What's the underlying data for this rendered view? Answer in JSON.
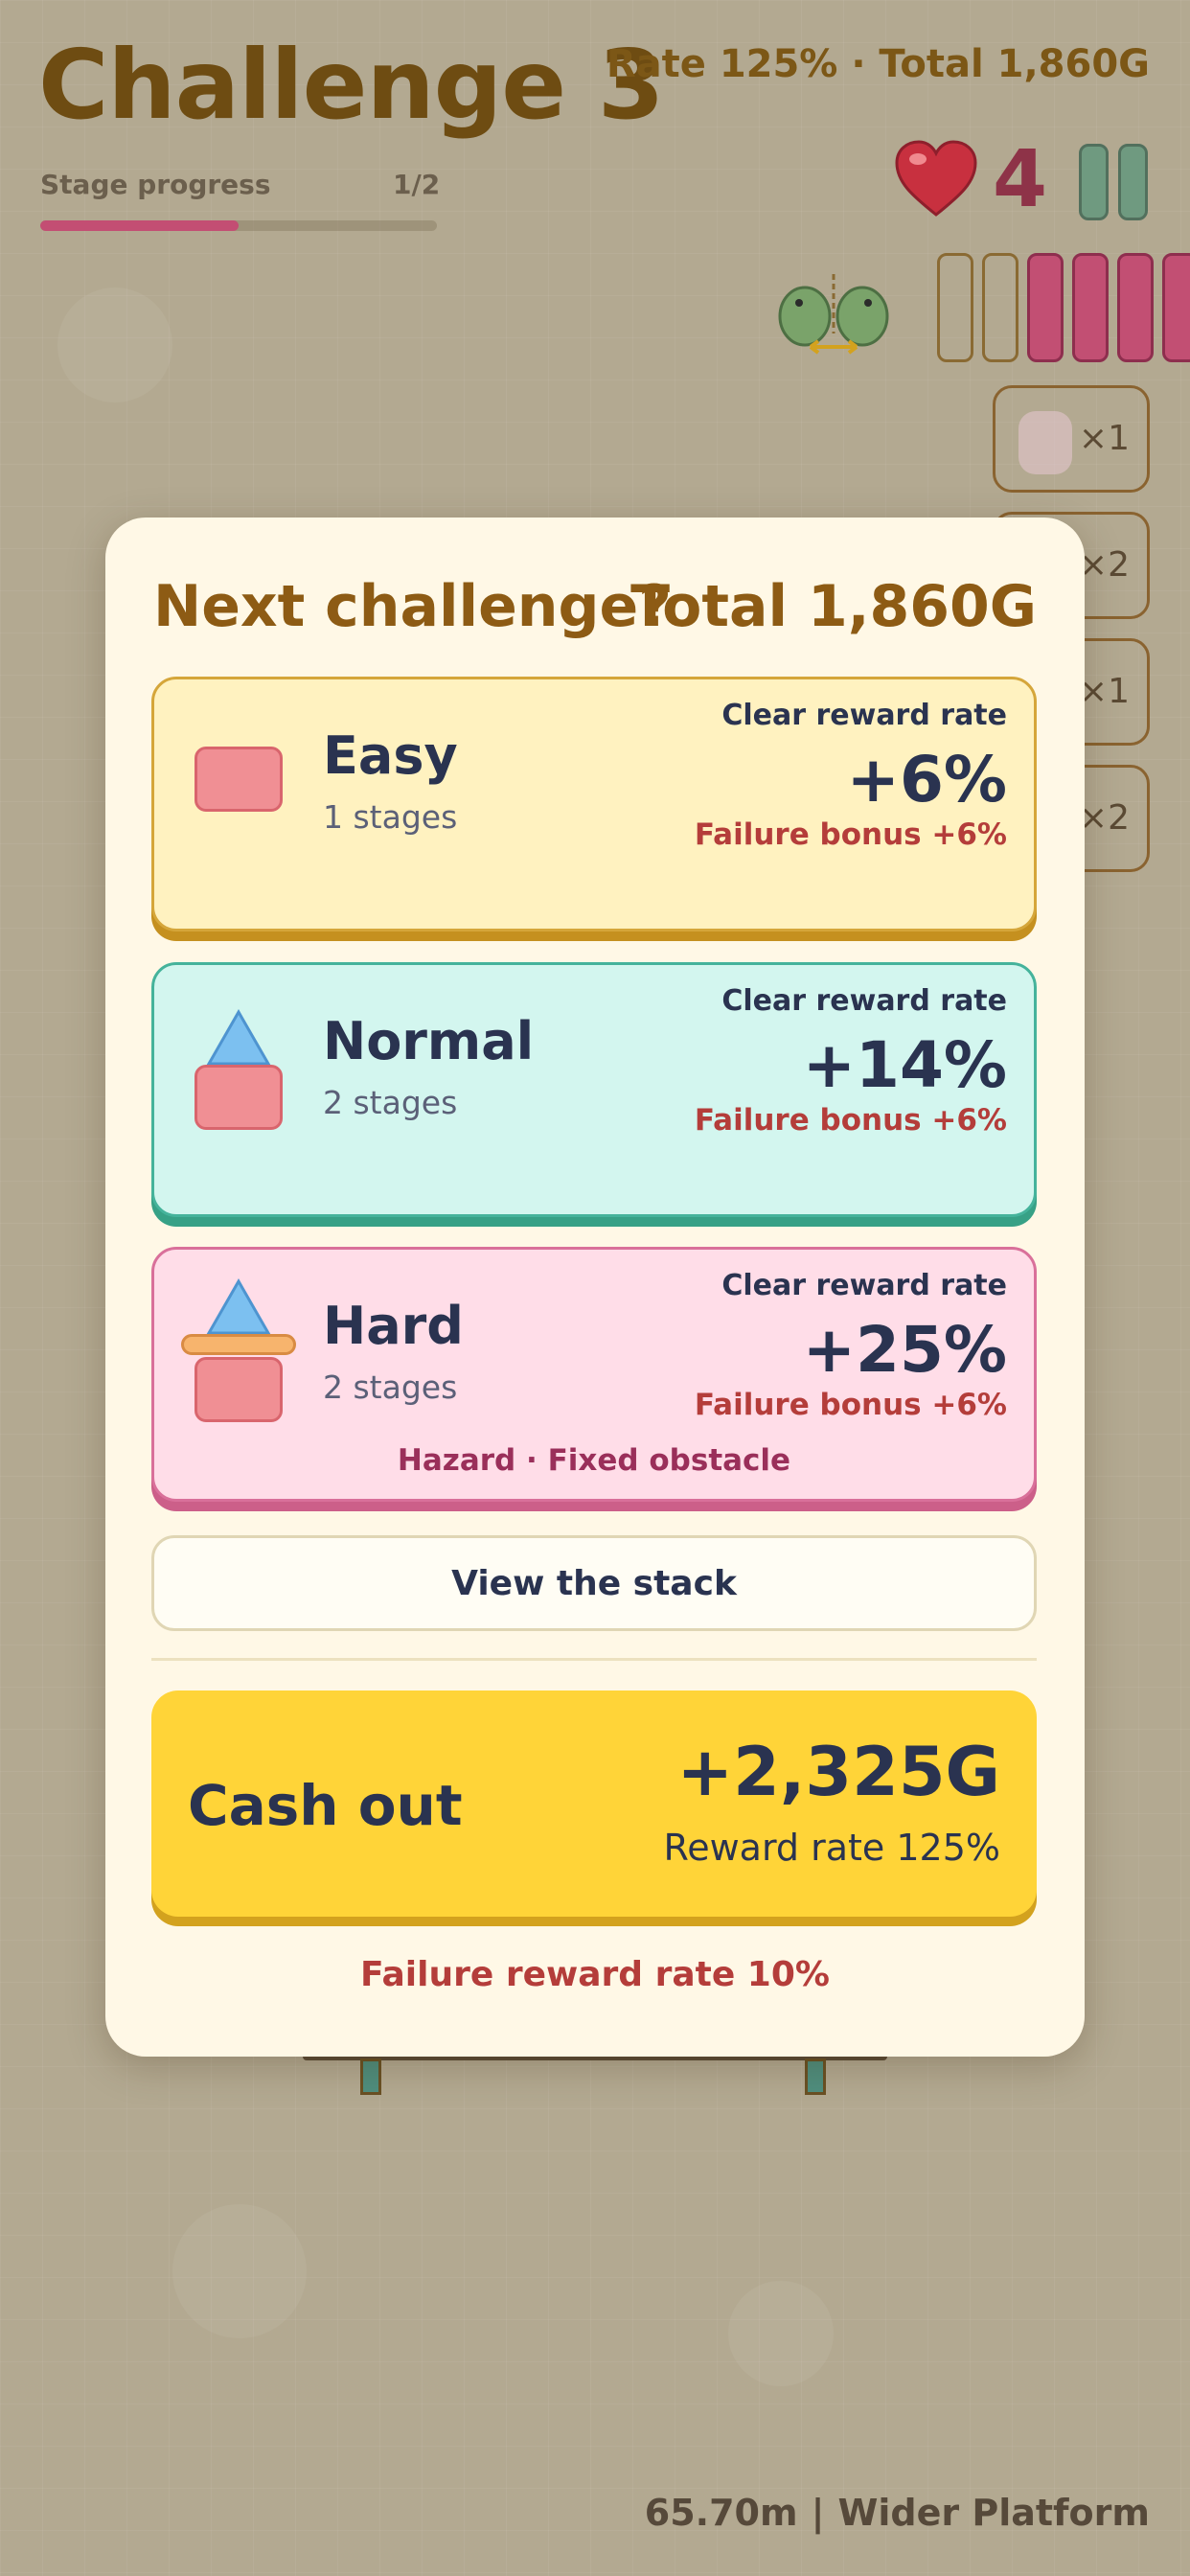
{
  "hud": {
    "title": "Challenge 3",
    "rate_total": "Rate 125% · Total 1,860G",
    "stage_label": "Stage progress",
    "stage_count": "1/2",
    "stage_progress": 0.5,
    "lives": "4",
    "slots_filled": 4,
    "slots_total": 6
  },
  "inventory": [
    {
      "qty": "×1",
      "icon": "ghost-doll-icon"
    },
    {
      "qty": "×2",
      "icon": "item-icon"
    },
    {
      "qty": "×1",
      "icon": "item-icon"
    },
    {
      "qty": "×2",
      "icon": "item-icon"
    }
  ],
  "modal": {
    "title": "Next challenge?",
    "total": "Total 1,860G",
    "options": [
      {
        "name": "Easy",
        "stages": "1 stages",
        "rate_label": "Clear reward rate",
        "rate": "+6%",
        "failure_bonus": "Failure bonus +6%",
        "tags": ""
      },
      {
        "name": "Normal",
        "stages": "2 stages",
        "rate_label": "Clear reward rate",
        "rate": "+14%",
        "failure_bonus": "Failure bonus +6%",
        "tags": ""
      },
      {
        "name": "Hard",
        "stages": "2 stages",
        "rate_label": "Clear reward rate",
        "rate": "+25%",
        "failure_bonus": "Failure bonus +6%",
        "tags": "Hazard · Fixed obstacle"
      }
    ],
    "view_stack": "View the stack",
    "cash_out": {
      "label": "Cash out",
      "amount": "+2,325G",
      "rate": "Reward rate 125%"
    },
    "failure_rate": "Failure reward rate 10%"
  },
  "footer": {
    "height": "65.70m",
    "separator": "|",
    "platform": "Wider Platform"
  },
  "colors": {
    "accent": "#ffd438",
    "title_brown": "#8d5b14",
    "danger_red": "#b43d3a",
    "heart": "#c8303f"
  }
}
